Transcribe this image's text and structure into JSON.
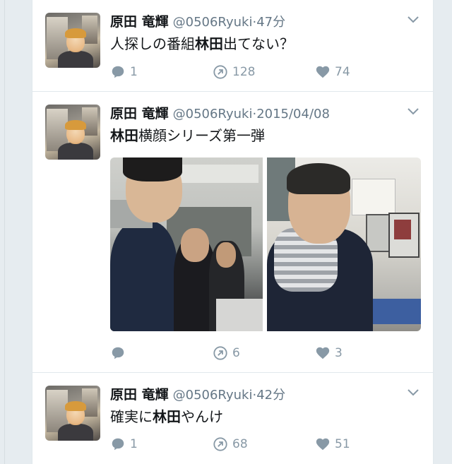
{
  "tweets": [
    {
      "name": "原田 竜輝",
      "handle": "@0506Ryuki",
      "separator": "·",
      "time": "47分",
      "text_before": "人探しの番組",
      "text_bold": "林田",
      "text_after": "出てない？",
      "replies": "1",
      "retweets": "128",
      "likes": "74"
    },
    {
      "name": "原田 竜輝",
      "handle": "@0506Ryuki",
      "separator": "·",
      "time": "2015/04/08",
      "text_before": "",
      "text_bold": "林田",
      "text_after": "横顔シリーズ第一弾",
      "replies": "",
      "retweets": "6",
      "likes": "3"
    },
    {
      "name": "原田 竜輝",
      "handle": "@0506Ryuki",
      "separator": "·",
      "time": "42分",
      "text_before": "確実に",
      "text_bold": "林田",
      "text_after": "やんけ",
      "replies": "1",
      "retweets": "68",
      "likes": "51"
    }
  ],
  "icons": {
    "reply": "reply-icon",
    "retweet": "retweet-icon",
    "like": "heart-icon",
    "caret": "chevron-down-icon"
  },
  "colors": {
    "text": "#14171a",
    "secondary": "#657786",
    "icon": "#8899a6",
    "divider": "#e1e8ed",
    "background": "#e6ecf0"
  }
}
